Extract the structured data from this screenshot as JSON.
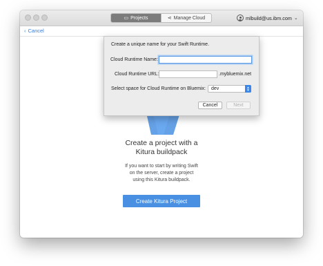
{
  "titlebar": {
    "tabs": [
      {
        "label": "Projects",
        "icon": "folder-icon",
        "active": true
      },
      {
        "label": "Manage Cloud",
        "icon": "cloud-share-icon",
        "active": false
      }
    ],
    "user": {
      "email": "mlbuild@us.ibm.com"
    }
  },
  "toolbar": {
    "back_label": "Cancel"
  },
  "dialog": {
    "heading": "Create a unique name for your Swift Runtime.",
    "name_label": "Cloud Runtime Name:",
    "name_value": "",
    "url_label": "Cloud Runtime URL:",
    "url_value": "",
    "url_suffix": ".mybluemix.net",
    "space_label": "Select space for Cloud Runtime on Bluemix:",
    "space_value": "dev",
    "cancel_label": "Cancel",
    "next_label": "Next"
  },
  "main": {
    "title_line1": "Create a project with a",
    "title_line2": "Kitura buildpack",
    "desc_line1": "If you want to start by writing Swift",
    "desc_line2": "on the server, create a project",
    "desc_line3": "using this Kitura buildpack.",
    "cta_label": "Create Kitura Project"
  },
  "colors": {
    "accent": "#4a90e2",
    "link": "#2f7de1",
    "graphic": "#4a90e2"
  }
}
